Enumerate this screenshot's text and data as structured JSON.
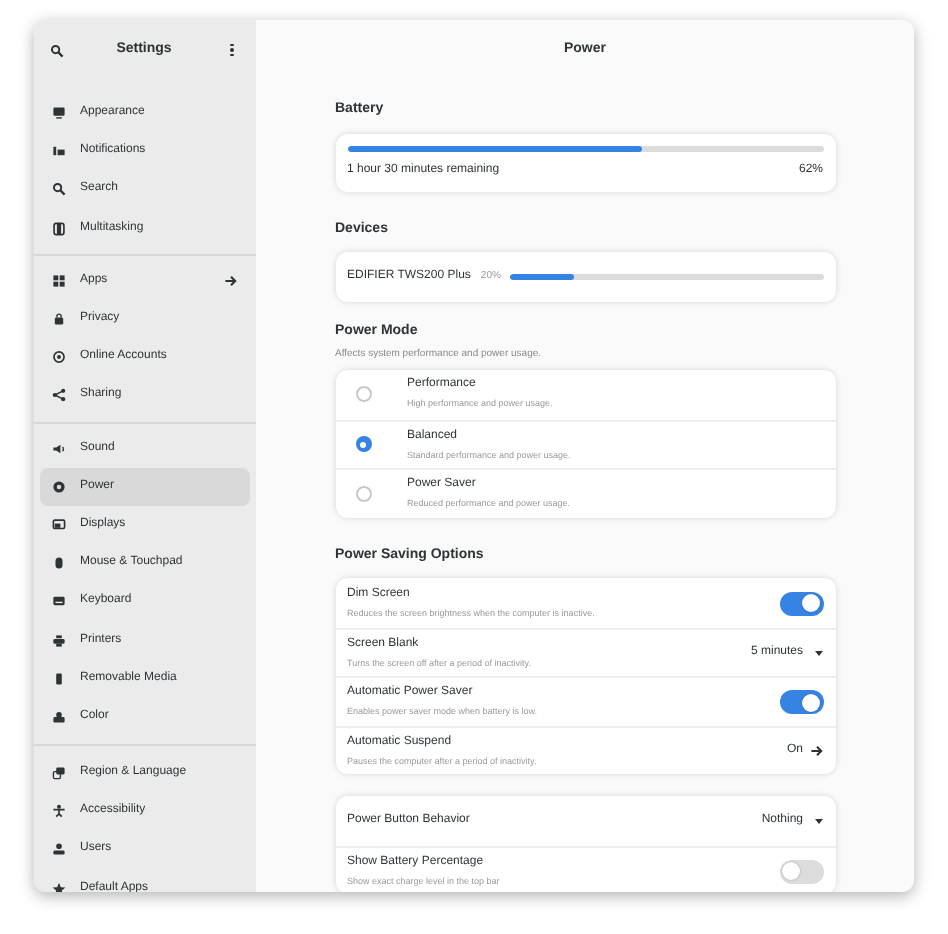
{
  "header": {
    "sidebar_title": "Settings",
    "title": "Power"
  },
  "sidebar": {
    "groups": [
      [
        {
          "label": "Appearance",
          "selected": false,
          "submenu": false
        },
        {
          "label": "Notifications",
          "selected": false,
          "submenu": false
        },
        {
          "label": "Search",
          "selected": false,
          "submenu": false
        },
        {
          "label": "Multitasking",
          "selected": false,
          "submenu": false
        }
      ],
      [
        {
          "label": "Apps",
          "selected": false,
          "submenu": true
        },
        {
          "label": "Privacy",
          "selected": false,
          "submenu": false
        },
        {
          "label": "Online Accounts",
          "selected": false,
          "submenu": false
        },
        {
          "label": "Sharing",
          "selected": false,
          "submenu": false
        }
      ],
      [
        {
          "label": "Sound",
          "selected": false,
          "submenu": false
        },
        {
          "label": "Power",
          "selected": true,
          "submenu": false
        },
        {
          "label": "Displays",
          "selected": false,
          "submenu": false
        },
        {
          "label": "Mouse & Touchpad",
          "selected": false,
          "submenu": false
        },
        {
          "label": "Keyboard",
          "selected": false,
          "submenu": false
        },
        {
          "label": "Printers",
          "selected": false,
          "submenu": false
        },
        {
          "label": "Removable Media",
          "selected": false,
          "submenu": false
        },
        {
          "label": "Color",
          "selected": false,
          "submenu": false
        }
      ],
      [
        {
          "label": "Region & Language",
          "selected": false,
          "submenu": false
        },
        {
          "label": "Accessibility",
          "selected": false,
          "submenu": false
        },
        {
          "label": "Users",
          "selected": false,
          "submenu": false
        },
        {
          "label": "Default Apps",
          "selected": false,
          "submenu": false
        }
      ]
    ]
  },
  "battery": {
    "heading": "Battery",
    "level": 0.62,
    "remaining": "1 hour 30 minutes remaining",
    "percent": "62%"
  },
  "devices": {
    "heading": "Devices",
    "items": [
      {
        "name": "EDIFIER TWS200 Plus",
        "percent": "20%",
        "level": 0.2
      }
    ]
  },
  "power_mode": {
    "heading": "Power Mode",
    "subtitle": "Affects system performance and power usage.",
    "options": [
      {
        "title": "Performance",
        "subtitle": "High performance and power usage.",
        "selected": false
      },
      {
        "title": "Balanced",
        "subtitle": "Standard performance and power usage.",
        "selected": true
      },
      {
        "title": "Power Saver",
        "subtitle": "Reduced performance and power usage.",
        "selected": false
      }
    ]
  },
  "power_saving": {
    "heading": "Power Saving Options",
    "rows": [
      {
        "kind": "switch",
        "title": "Dim Screen",
        "subtitle": "Reduces the screen brightness when the computer is inactive.",
        "on": true
      },
      {
        "kind": "dropdown",
        "title": "Screen Blank",
        "subtitle": "Turns the screen off after a period of inactivity.",
        "value": "5 minutes"
      },
      {
        "kind": "switch",
        "title": "Automatic Power Saver",
        "subtitle": "Enables power saver mode when battery is low.",
        "on": true
      },
      {
        "kind": "link",
        "title": "Automatic Suspend",
        "subtitle": "Pauses the computer after a period of inactivity.",
        "value": "On"
      }
    ]
  },
  "general": {
    "rows": [
      {
        "kind": "dropdown",
        "title": "Power Button Behavior",
        "value": "Nothing"
      },
      {
        "kind": "switch",
        "title": "Show Battery Percentage",
        "subtitle": "Show exact charge level in the top bar",
        "on": false
      }
    ]
  }
}
